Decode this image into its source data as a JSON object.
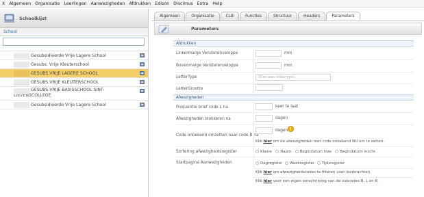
{
  "menu": [
    "X",
    "Algemeen",
    "Organisatie",
    "Leerlingen",
    "Aanwezigheden",
    "Afdrukken",
    "Edison",
    "Discimus",
    "Extra",
    "Help"
  ],
  "left_panel": {
    "title": "Schoolkijst",
    "column_header": "School",
    "search_value": "",
    "schools": [
      {
        "name": "Gesubsidieerde Vrije Lagere School",
        "selected": false
      },
      {
        "name": "Gesubs. Vrije Kleuterschool",
        "selected": false
      },
      {
        "name": "GESUBS.VRIJE LAGERE SCHOOL",
        "selected": true
      },
      {
        "name": "GESUBS.VRIJE KLEUTERSCHOOL",
        "selected": false
      },
      {
        "name": "GESUBS.VRIJE BASISSCHOOL SINT-LIEVENSCOLLEGE",
        "selected": false
      },
      {
        "name": "Gesubsidieerde Vrije Lagere School",
        "selected": false
      }
    ]
  },
  "tabs": [
    "Algemeen",
    "Organisatie",
    "CLB",
    "Functies",
    "Structuur",
    "Headers",
    "Parameters"
  ],
  "active_tab": "Parameters",
  "sub_header_title": "Parameters",
  "afdrukken": {
    "section_title": "Afdrukken",
    "linkermarge_label": "Linkermarge Vensterenveloppe",
    "linkermarge_value": "",
    "linkermarge_unit": "mm",
    "bovenmarge_label": "Bovenmarge Vensterenveloppe",
    "bovenmarge_value": "",
    "bovenmarge_unit": "mm",
    "lettertype_label": "LetterType",
    "lettertype_placeholder": "(Kies een lettertype)",
    "lettergrootte_label": "LetterGrootte",
    "lettergrootte_value": ""
  },
  "afwezigheden": {
    "section_title": "Afwezigheden",
    "frequentie_label": "Frequentie brief code L na",
    "frequentie_suffix": "keer te laat",
    "blokkeren_label": "Afwezigheden blokkeren na",
    "blokkeren_suffix": "dagen",
    "omzetten_label": "Code onbekend omzetten naar code B na",
    "omzetten_suffix": "dagen",
    "omzetten_note_pre": "Klik ",
    "omzetten_note_link": "hier",
    "omzetten_note_post": " om de afwezigheden met code onbekend NU om te zetten.",
    "sortering_label": "Sortering afwezigheidsregister",
    "sortering_options": [
      "Klasre",
      "Naam",
      "Begindatum klas",
      "Begindatum inschr."
    ],
    "startpagina_label": "Startpagina Aanwezigheden",
    "startpagina_options": [
      "Dagregister",
      "Weekregister",
      "Tijdsregister"
    ],
    "note1_pre": "Klik ",
    "note1_link": "hier",
    "note1_post": " om afwezigheidscodes te filteren voor leerkrachten.",
    "note2_pre": "Klik ",
    "note2_link": "hier",
    "note2_post": " voor een eigen omschrijving van de subcodes B, L en R."
  },
  "colors": {
    "selected_row": "#f4cf68",
    "section_bg": "#eef3f9",
    "info_icon": "#f0b419"
  }
}
